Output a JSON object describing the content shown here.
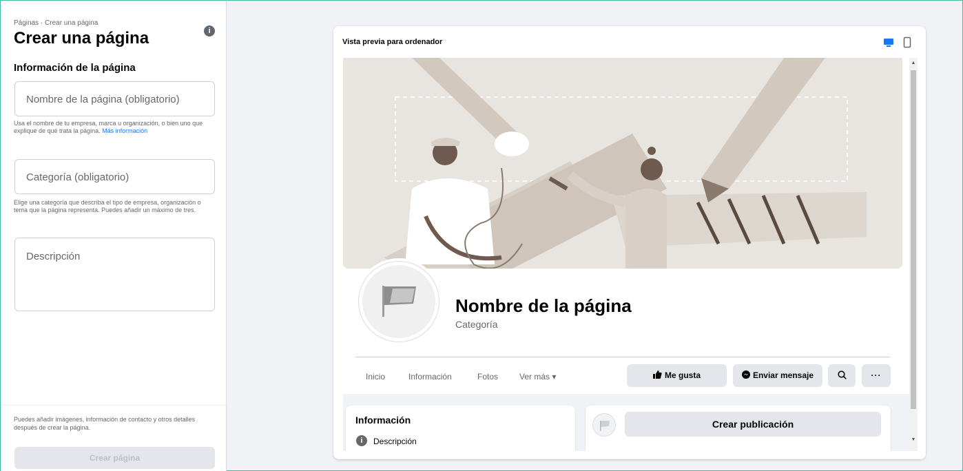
{
  "left_panel": {
    "breadcrumb": "Páginas · Crear una página",
    "title": "Crear una página",
    "section_title": "Información de la página",
    "name_field": {
      "placeholder": "Nombre de la página (obligatorio)"
    },
    "name_help": "Usa el nombre de tu empresa, marca u organización, o bien uno que explique de qué trata la página.",
    "name_help_link": "Más información",
    "category_field": {
      "placeholder": "Categoría (obligatorio)"
    },
    "category_help": "Elige una categoría que describa el tipo de empresa, organización o tema que la página representa. Puedes añadir un máximo de tres.",
    "description_field": {
      "placeholder": "Descripción"
    },
    "footer_note": "Puedes añadir imágenes, información de contacto y otros detalles después de crear la página.",
    "create_button": "Crear página"
  },
  "preview": {
    "title": "Vista previa para ordenador",
    "page_name": "Nombre de la página",
    "category": "Categoría",
    "tabs": [
      {
        "label": "Inicio"
      },
      {
        "label": "Información"
      },
      {
        "label": "Fotos"
      },
      {
        "label": "Ver más ▾"
      }
    ],
    "buttons": {
      "like": "Me gusta",
      "message": "Enviar mensaje"
    },
    "info_card": {
      "title": "Información",
      "description": "Descripción"
    },
    "post_button": "Crear publicación"
  },
  "colors": {
    "accent": "#1877f2",
    "disabled_button": "#e4e6eb",
    "background": "#f0f2f5",
    "frame_border": "#3dbd9a"
  },
  "icons": [
    "info-icon",
    "desktop-icon",
    "mobile-icon",
    "flag-icon",
    "thumbs-up-icon",
    "messenger-icon",
    "search-icon",
    "more-icon"
  ]
}
